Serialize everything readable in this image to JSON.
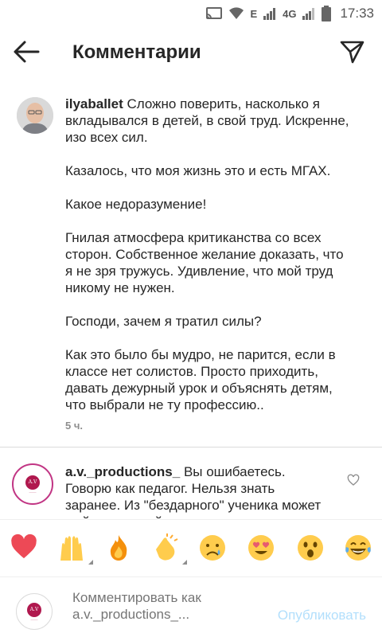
{
  "status_bar": {
    "network_e": "E",
    "network_4g": "4G",
    "time": "17:33",
    "icons": [
      "cast-icon",
      "wifi-icon",
      "signal-icon",
      "signal-icon",
      "battery-icon"
    ]
  },
  "header": {
    "title": "Комментарии",
    "back_icon": "arrow-left-icon",
    "send_icon": "paper-plane-icon"
  },
  "caption": {
    "username": "ilyaballet",
    "paragraphs": [
      "Сложно поверить, насколько я вкладывался в детей, в свой труд. Искренне, изо всех сил.",
      "Казалось, что моя жизнь это и есть МГАХ.",
      "Какое недоразумение!",
      "Гнилая атмосфера критиканства со всех сторон. Собственное желание доказать, что я не зря тружусь. Удивление, что мой труд никому не нужен.",
      "Господи, зачем я тратил силы?",
      "Как это было бы мудро, не парится, если в классе нет солистов. Просто приходить, давать дежурный урок и объяснять детям, что выбрали не ту профессию.."
    ],
    "time": "5 ч."
  },
  "reply": {
    "username": "a.v._productions_",
    "text": " Вы ошибаетесь. Говорю как педагог. Нельзя знать заранее. Из \"бездарного\" ученика может выйти хороший артист",
    "avatar_text": "A.V"
  },
  "emoji_bar": {
    "emojis": [
      "red-heart",
      "raising-hands",
      "fire",
      "clapping-hands",
      "crying-face",
      "heart-eyes-face",
      "astonished-face",
      "tears-of-joy-face"
    ]
  },
  "composer": {
    "placeholder": "Комментировать как a.v._productions_...",
    "publish_label": "Опубликовать",
    "avatar_text": "A.V"
  },
  "colors": {
    "text": "#262626",
    "secondary": "#8e8e8e",
    "publish_disabled": "#b2dffc",
    "heart": "#ed4956",
    "brand": "#b0184e"
  }
}
